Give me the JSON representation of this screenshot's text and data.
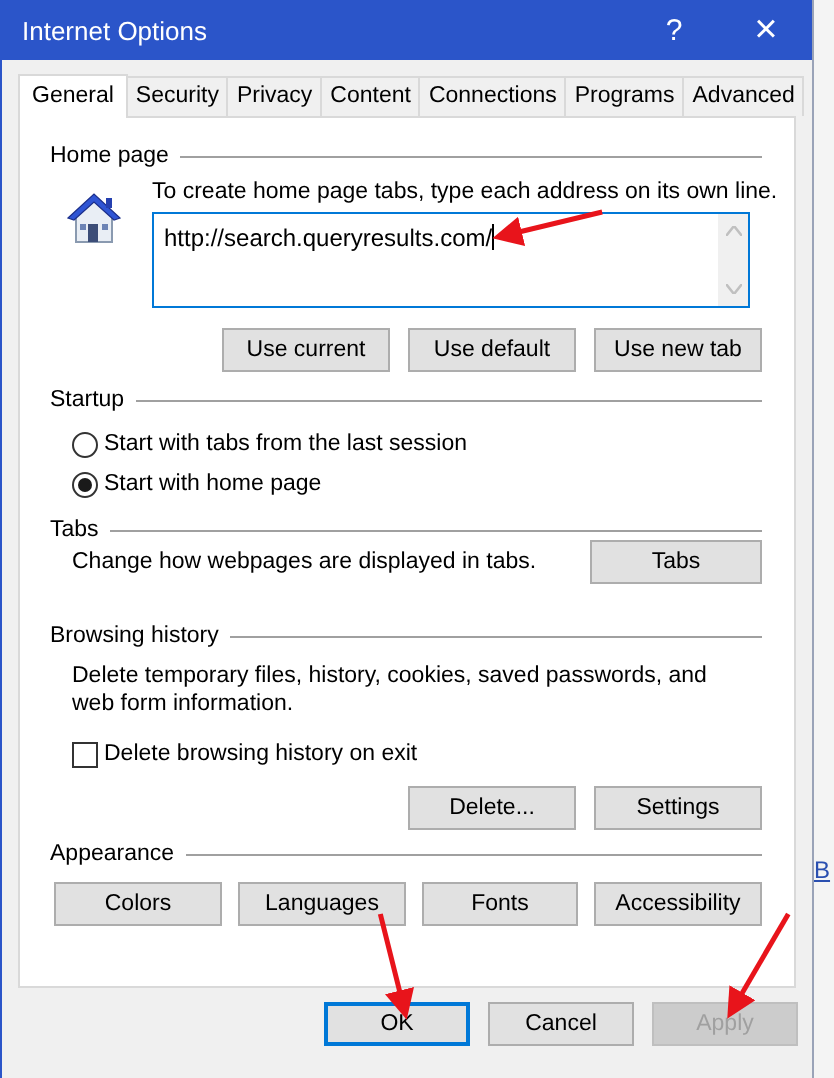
{
  "window": {
    "title": "Internet Options",
    "help": "?",
    "close": "×"
  },
  "tabs": [
    {
      "label": "General",
      "selected": true
    },
    {
      "label": "Security",
      "selected": false
    },
    {
      "label": "Privacy",
      "selected": false
    },
    {
      "label": "Content",
      "selected": false
    },
    {
      "label": "Connections",
      "selected": false
    },
    {
      "label": "Programs",
      "selected": false
    },
    {
      "label": "Advanced",
      "selected": false
    }
  ],
  "home_page": {
    "heading": "Home page",
    "instruction": "To create home page tabs, type each address on its own line.",
    "address": "http://search.queryresults.com/",
    "pointed": true,
    "buttons": [
      {
        "label": "Use current"
      },
      {
        "label": "Use default"
      },
      {
        "label": "Use new tab"
      }
    ]
  },
  "startup": {
    "heading": "Startup",
    "options": [
      {
        "label": "Start with tabs from the last session",
        "selected": false
      },
      {
        "label": "Start with home page",
        "selected": true
      }
    ]
  },
  "tabs_section": {
    "heading": "Tabs",
    "description": "Change how webpages are displayed in tabs.",
    "button": "Tabs"
  },
  "browsing_history": {
    "heading": "Browsing history",
    "description": "Delete temporary files, history, cookies, saved passwords, and web form information.",
    "checkbox": {
      "label": "Delete browsing history on exit",
      "checked": false
    },
    "buttons": [
      {
        "label": "Delete..."
      },
      {
        "label": "Settings"
      }
    ]
  },
  "appearance": {
    "heading": "Appearance",
    "buttons": [
      {
        "label": "Colors",
        "pointed": false
      },
      {
        "label": "Languages",
        "pointed": false
      },
      {
        "label": "Fonts",
        "pointed": false
      },
      {
        "label": "Accessibility",
        "pointed": false
      }
    ]
  },
  "dialog_buttons": [
    {
      "label": "OK",
      "default": true,
      "disabled": false,
      "pointed": true
    },
    {
      "label": "Cancel",
      "default": false,
      "disabled": false,
      "pointed": false
    },
    {
      "label": "Apply",
      "default": false,
      "disabled": true,
      "pointed": true
    }
  ],
  "background_text": "B"
}
